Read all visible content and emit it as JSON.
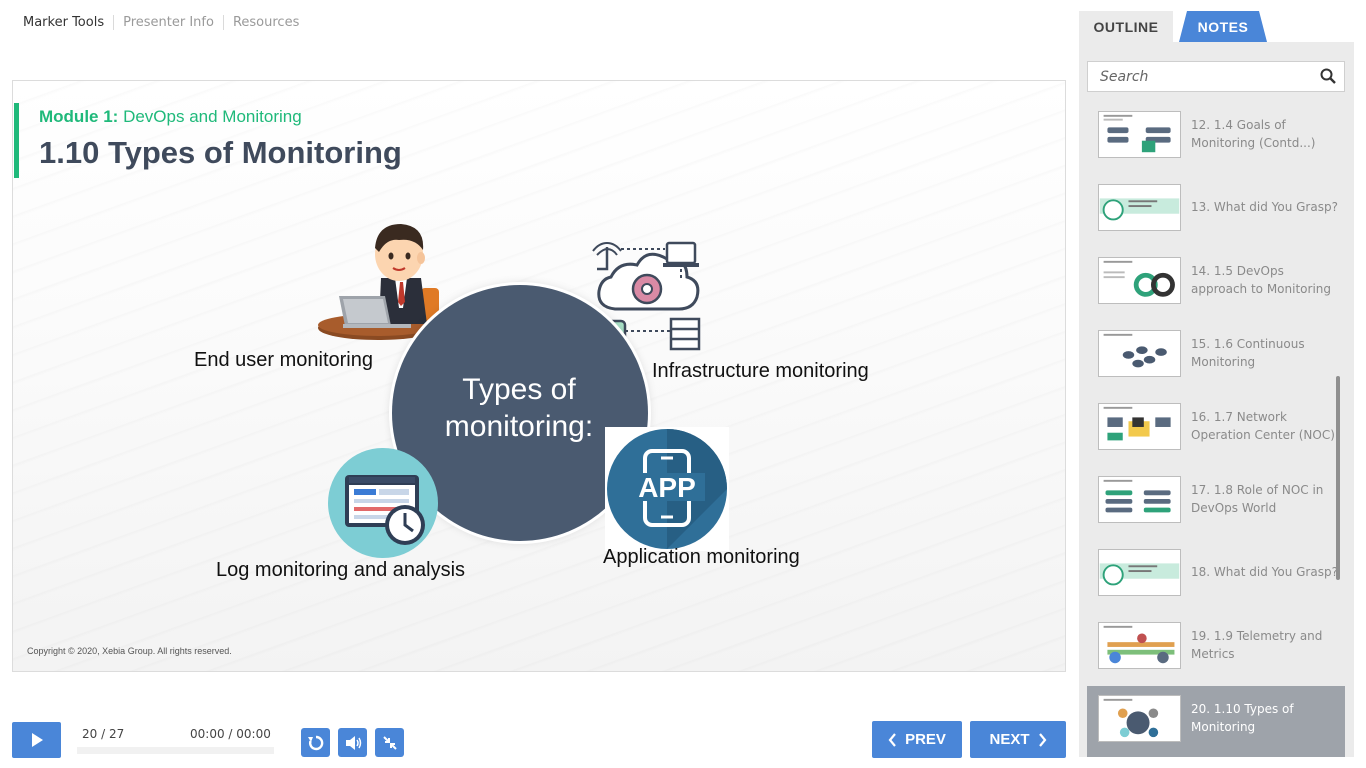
{
  "top_links": [
    "Marker Tools",
    "Presenter Info",
    "Resources"
  ],
  "slide": {
    "module_label": "Module 1:",
    "module_name": "DevOps and Monitoring",
    "title": "1.10 Types of Monitoring",
    "center_text_line1": "Types of",
    "center_text_line2": "monitoring:",
    "labels": {
      "end_user": "End user monitoring",
      "infrastructure": "Infrastructure monitoring",
      "log": "Log monitoring and analysis",
      "application": "Application monitoring"
    },
    "app_icon_text": "APP",
    "copyright": "Copyright © 2020, Xebia Group. All rights reserved.",
    "accent_color": "#1fb97a"
  },
  "player": {
    "slide_counter": "20 / 27",
    "time": "00:00 / 00:00",
    "prev_label": "PREV",
    "next_label": "NEXT",
    "controls": [
      "play-icon",
      "replay-icon",
      "volume-icon",
      "collapse-icon"
    ],
    "button_color": "#4a86d8"
  },
  "sidebar": {
    "tabs": [
      "OUTLINE",
      "NOTES"
    ],
    "search_placeholder": "Search",
    "items": [
      {
        "label": "12. 1.4 Goals of Monitoring (Contd...)",
        "active": false
      },
      {
        "label": "13. What did You Grasp?",
        "active": false
      },
      {
        "label": "14. 1.5 DevOps approach to Monitoring",
        "active": false
      },
      {
        "label": "15. 1.6 Continuous Monitoring",
        "active": false
      },
      {
        "label": "16. 1.7 Network Operation Center (NOC)",
        "active": false
      },
      {
        "label": "17. 1.8 Role of NOC in DevOps World",
        "active": false
      },
      {
        "label": "18. What did You Grasp?",
        "active": false
      },
      {
        "label": "19. 1.9 Telemetry and Metrics",
        "active": false
      },
      {
        "label": "20. 1.10 Types of Monitoring",
        "active": true
      }
    ]
  }
}
